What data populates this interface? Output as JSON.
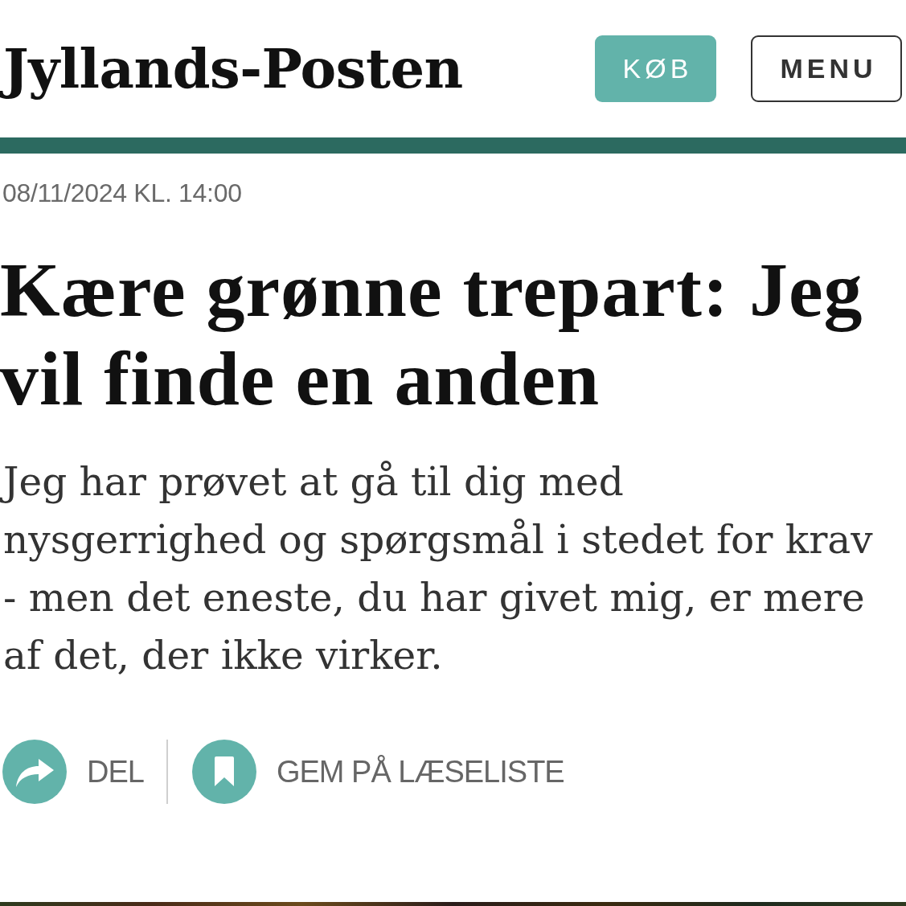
{
  "header": {
    "logo": "Jyllands-Posten",
    "buttons": [
      {
        "label": "KØB",
        "kind": "filled"
      },
      {
        "label": "MENU",
        "kind": "outline"
      }
    ]
  },
  "article": {
    "timestamp": "08/11/2024 KL. 14:00",
    "headline": "Kære grønne trepart: Jeg vil finde en anden",
    "lead": "Jeg har prøvet at gå til dig med nysgerrighed og spørgsmål i stedet for krav - men det eneste, du har givet mig, er mere af det, der ikke virker.",
    "actions": [
      {
        "label": "DEL",
        "kind": "share"
      },
      {
        "label": "GEM PÅ LÆSELISTE",
        "kind": "bookmark"
      }
    ]
  }
}
